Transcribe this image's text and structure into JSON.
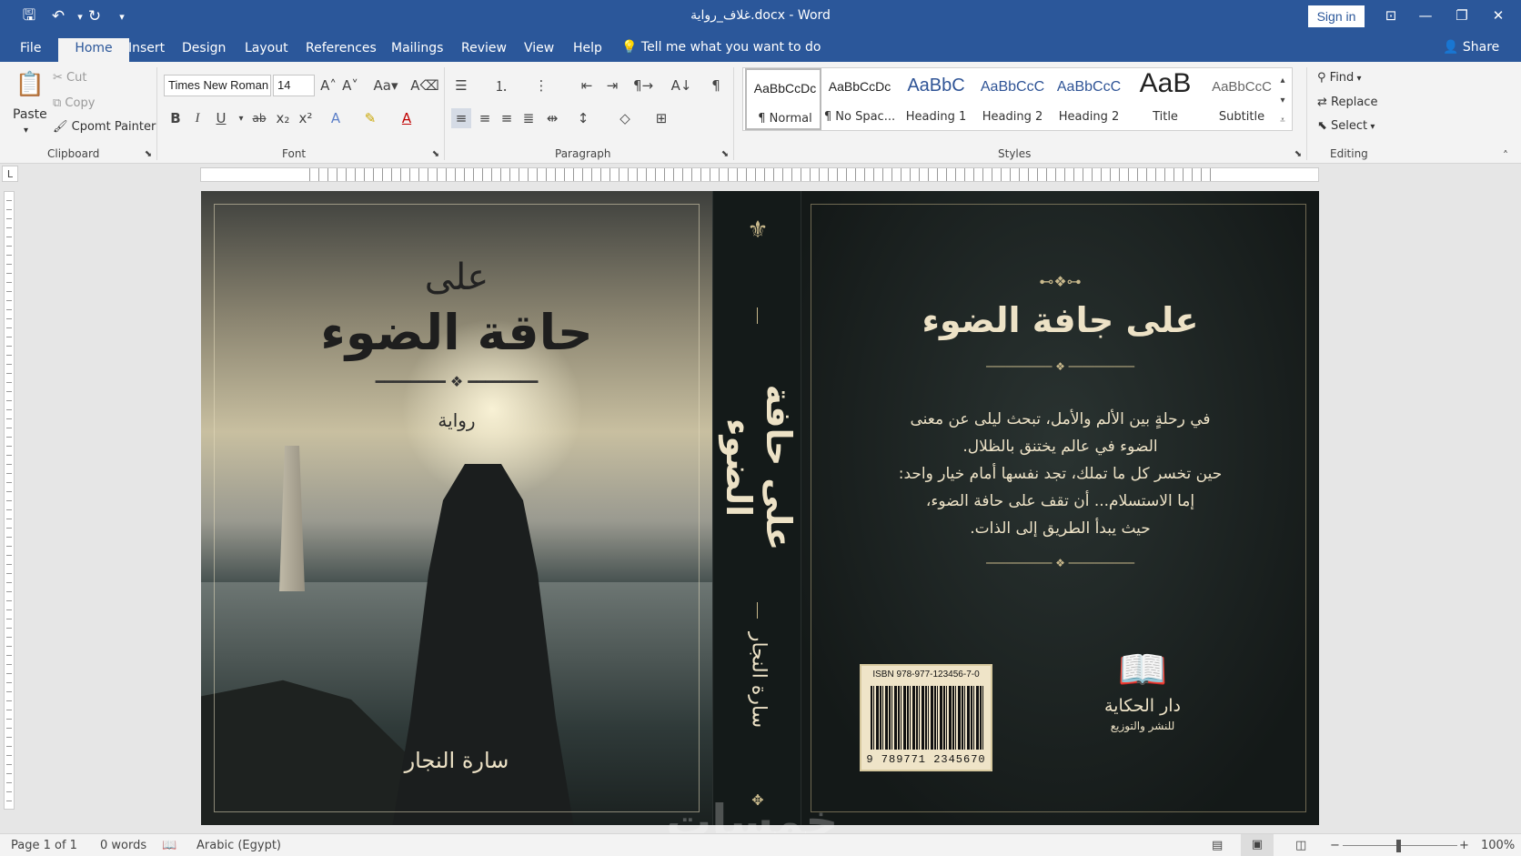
{
  "title_bar": {
    "title": "غلاف_رواية.docx  -  Word",
    "sign_in": "Sign in"
  },
  "tabs": [
    "File",
    "Home",
    "Insert",
    "Design",
    "Layout",
    "References",
    "Mailings",
    "Review",
    "View",
    "Help"
  ],
  "active_tab": "Home",
  "tell_me": "Tell me what you want to do",
  "share": "Share",
  "clipboard": {
    "paste": "Paste",
    "cut": "Cut",
    "copy": "Copy",
    "format_painter": "Cpomt Painter",
    "label": "Clipboard"
  },
  "font": {
    "name": "Times New Roman",
    "size": "14",
    "label": "Font"
  },
  "paragraph": {
    "label": "Paragraph"
  },
  "styles": {
    "label": "Styles",
    "items": [
      {
        "preview": "AaBbCcDc",
        "name": "¶ Normal"
      },
      {
        "preview": "AaBbCcDc",
        "name": "¶ No Spac..."
      },
      {
        "preview": "AaBbC",
        "name": "Heading 1"
      },
      {
        "preview": "AaBbCcC",
        "name": "Heading 2"
      },
      {
        "preview": "AaBbCcC",
        "name": "Heading 2"
      },
      {
        "preview": "AaB",
        "name": "Title"
      },
      {
        "preview": "AaBbCcC",
        "name": "Subtitle"
      }
    ]
  },
  "editing": {
    "find": "Find",
    "replace": "Replace",
    "select": "Select",
    "label": "Editing"
  },
  "cover": {
    "front_line1": "على",
    "front_line2": "حاقة الضوء",
    "front_genre": "رواية",
    "front_author": "سارة النجار",
    "spine_title": "على حافة الضوء",
    "spine_author": "سارة النجار",
    "back_title": "على جافة الضوء",
    "back_blurb": [
      "في رحلةٍ بين الألم والأمل، تبحث ليلى عن معنى",
      "الضوء في عالم يختنق بالظلال.",
      "حين تخسر كل ما تملك، تجد نفسها أمام خيار واحد:",
      "إما الاستسلام...  أن تقف على حافة الضوء،",
      "حيث يبدأ الطريق إلى الذات."
    ],
    "isbn": "ISBN 978-977-123456-7-0",
    "barcode_digits": "9 789771 2345670",
    "publisher": "دار الحكاية",
    "publisher_sub": "للنشر والتوزيع"
  },
  "watermark": "خمسات",
  "status": {
    "page": "Page 1 of 1",
    "words": "0 words",
    "language": "Arabic (Egypt)",
    "zoom": "100%"
  }
}
